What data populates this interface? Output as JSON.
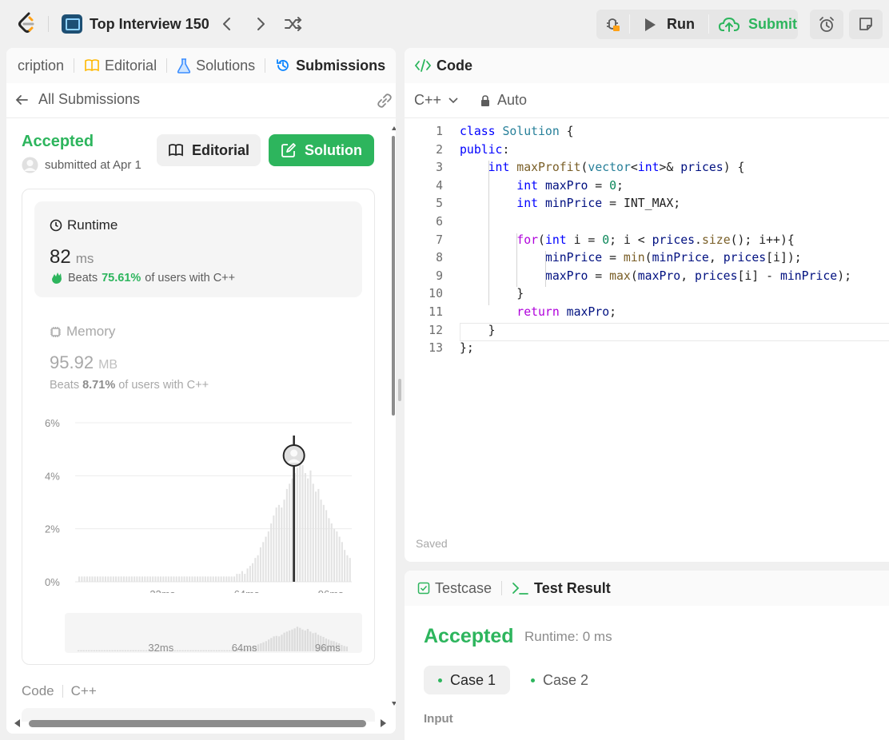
{
  "header": {
    "list_title": "Top Interview 150",
    "run_label": "Run",
    "submit_label": "Submit"
  },
  "left_tabs": [
    "cription",
    "Editorial",
    "Solutions",
    "Submissions"
  ],
  "submission_bar": {
    "back_label": "All Submissions"
  },
  "result": {
    "status": "Accepted",
    "submitted_text": "submitted at Apr 1",
    "editorial_button": "Editorial",
    "solution_button": "Solution"
  },
  "runtime": {
    "label": "Runtime",
    "value": "82",
    "unit": "ms",
    "beats_prefix": "Beats",
    "beats_percent": "75.61%",
    "beats_suffix": "of users with C++"
  },
  "memory": {
    "label": "Memory",
    "value": "95.92",
    "unit": "MB",
    "beats_prefix": "Beats",
    "beats_percent": "8.71%",
    "beats_suffix": "of users with C++"
  },
  "chart_data": {
    "type": "bar",
    "title": "",
    "xlabel": "",
    "ylabel": "",
    "y_ticks": [
      "6%",
      "4%",
      "2%",
      "0%"
    ],
    "x_ticks": [
      "32ms",
      "64ms",
      "96ms"
    ],
    "ylim": [
      0,
      6
    ],
    "xlim": [
      0,
      104
    ],
    "marker_x": 82,
    "values": [
      0.2,
      0.2,
      0.2,
      0.2,
      0.2,
      0.2,
      0.2,
      0.2,
      0.2,
      0.2,
      0.2,
      0.2,
      0.2,
      0.2,
      0.2,
      0.2,
      0.2,
      0.2,
      0.2,
      0.2,
      0.2,
      0.2,
      0.2,
      0.2,
      0.2,
      0.2,
      0.2,
      0.2,
      0.2,
      0.2,
      0.2,
      0.2,
      0.2,
      0.2,
      0.2,
      0.2,
      0.2,
      0.2,
      0.2,
      0.2,
      0.2,
      0.2,
      0.2,
      0.2,
      0.2,
      0.2,
      0.2,
      0.2,
      0.2,
      0.2,
      0.2,
      0.2,
      0.2,
      0.2,
      0.2,
      0.2,
      0.2,
      0.2,
      0.2,
      0.2,
      0.3,
      0.3,
      0.4,
      0.3,
      0.5,
      0.6,
      0.7,
      0.9,
      1.0,
      1.3,
      1.5,
      1.7,
      1.9,
      2.2,
      2.5,
      2.8,
      2.9,
      2.8,
      3.1,
      3.5,
      3.7,
      3.9,
      4.1,
      4.3,
      4.6,
      4.4,
      4.1,
      3.9,
      4.2,
      3.7,
      3.4,
      3.5,
      3.1,
      2.9,
      2.7,
      2.4,
      2.2,
      2.0,
      1.9,
      1.7,
      1.5,
      1.2,
      1.0,
      0.9
    ],
    "minimap_x_ticks": [
      "32ms",
      "64ms",
      "96ms"
    ]
  },
  "code_footer": {
    "label": "Code",
    "lang": "C++"
  },
  "editor": {
    "title": "Code",
    "language": "C++",
    "mode": "Auto",
    "saved": "Saved",
    "lines": [
      "class Solution {",
      "public:",
      "    int maxProfit(vector<int>& prices) {",
      "        int maxPro = 0;",
      "        int minPrice = INT_MAX;",
      "",
      "        for(int i = 0; i < prices.size(); i++){",
      "            minPrice = min(minPrice, prices[i]);",
      "            maxPro = max(maxPro, prices[i] - minPrice);",
      "        }",
      "        return maxPro;",
      "    }",
      "};"
    ],
    "line_numbers": [
      "1",
      "2",
      "3",
      "4",
      "5",
      "6",
      "7",
      "8",
      "9",
      "10",
      "11",
      "12",
      "13"
    ]
  },
  "bottom": {
    "testcase_tab": "Testcase",
    "result_tab": "Test Result",
    "status": "Accepted",
    "runtime": "Runtime: 0 ms",
    "case1": "Case 1",
    "case2": "Case 2",
    "input_label": "Input"
  },
  "colors": {
    "accent": "#2db55d",
    "link": "#0a84ff",
    "text": "#262626"
  }
}
